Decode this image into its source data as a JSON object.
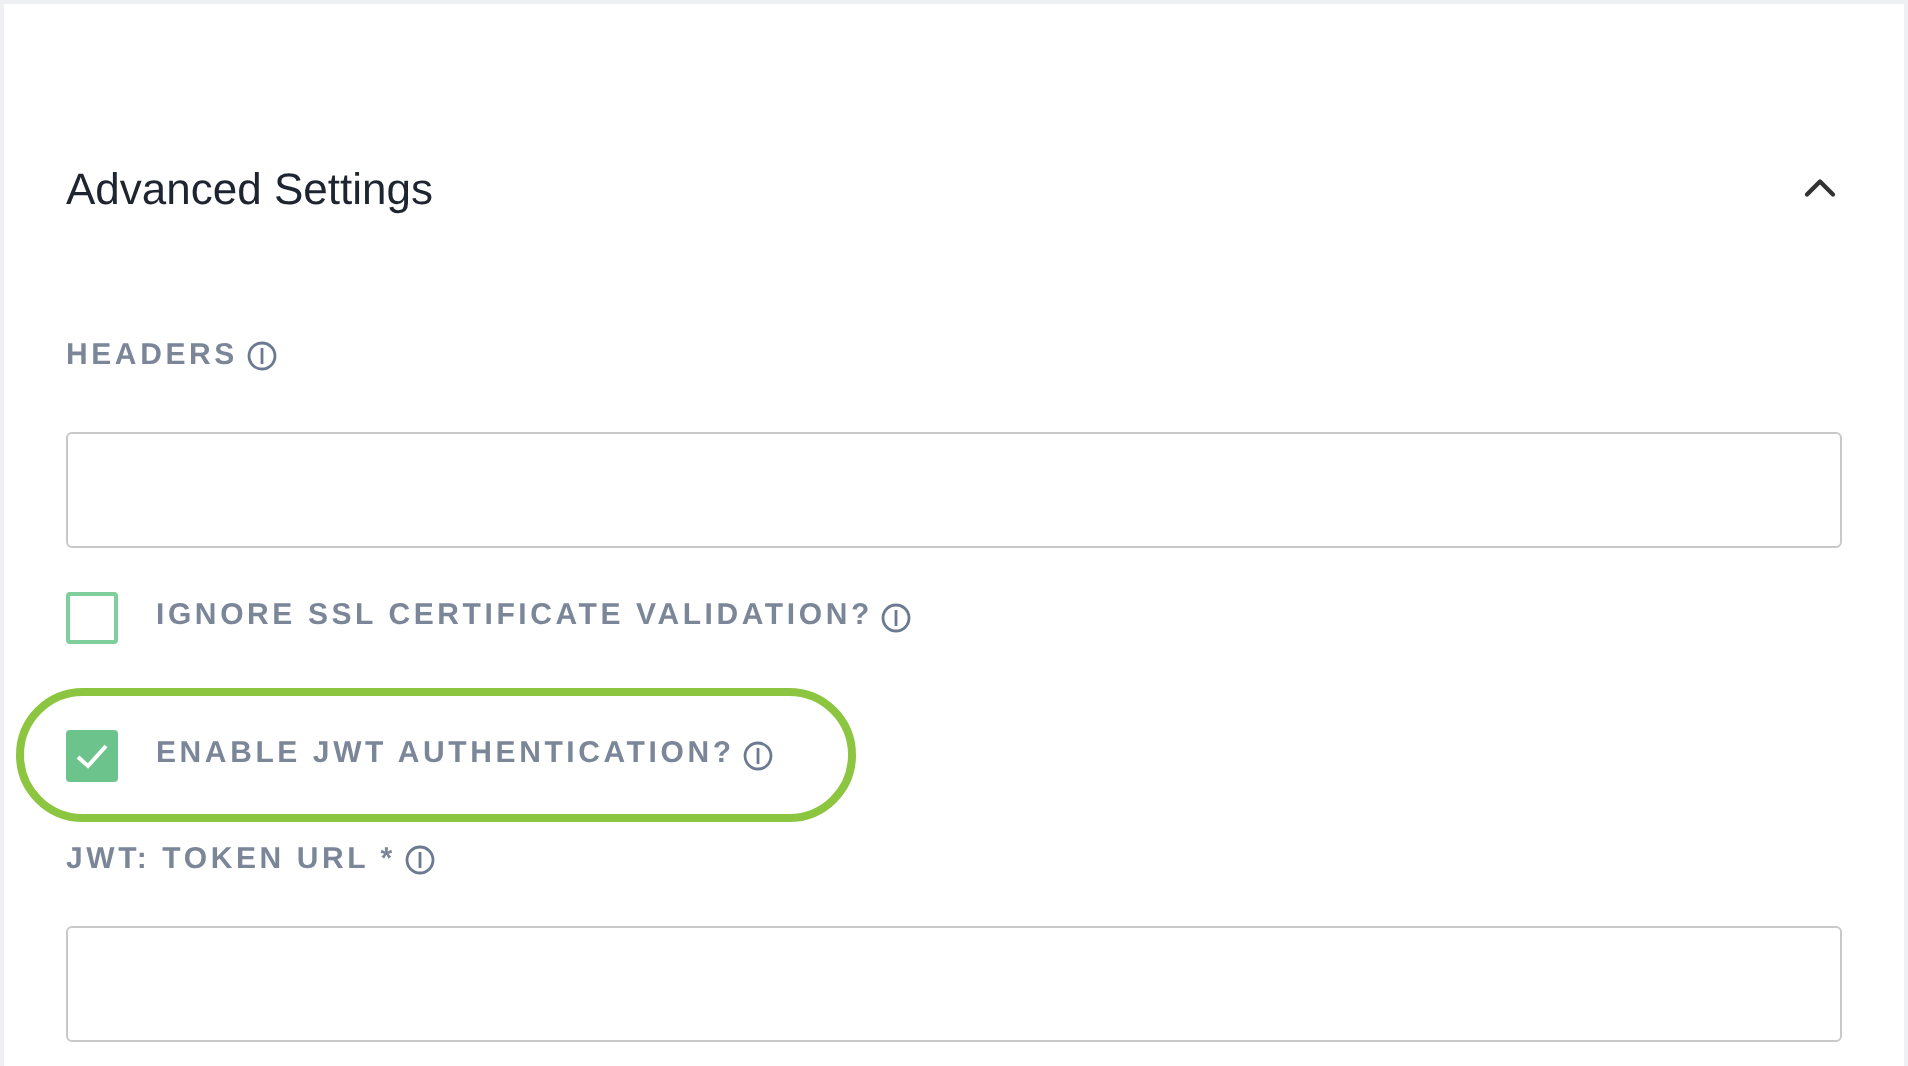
{
  "section": {
    "title": "Advanced Settings",
    "expanded": true
  },
  "fields": [
    {
      "kind": "text",
      "label": "HEADERS"
    },
    {
      "kind": "checkbox",
      "label": "IGNORE SSL CERTIFICATE VALIDATION?",
      "checked": false,
      "highlighted": false
    },
    {
      "kind": "checkbox",
      "label": "ENABLE JWT AUTHENTICATION?",
      "checked": true,
      "highlighted": true
    },
    {
      "kind": "text",
      "label": "JWT: TOKEN URL *"
    }
  ]
}
